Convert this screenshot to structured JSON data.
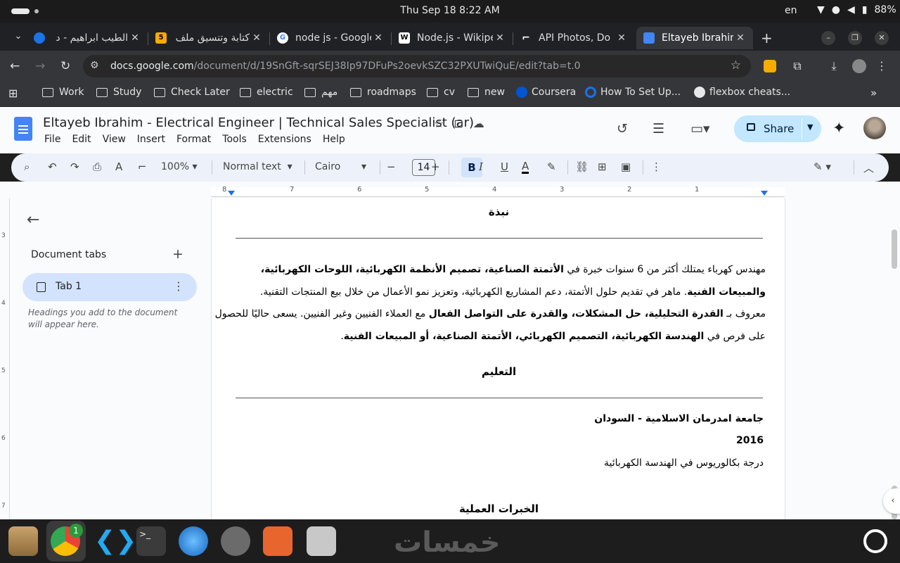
{
  "system": {
    "datetime": "Thu Sep 18  8:22 AM",
    "lang": "en",
    "battery": "88%"
  },
  "tabs": [
    {
      "title": "الطيب ابراهيم - د",
      "favicon_color": "#1a73e8"
    },
    {
      "title": "كتابة وتنسيق ملف",
      "favicon_color": "#f9ab00",
      "favicon_text": "5"
    },
    {
      "title": "node js - Google",
      "favicon_color": "#ffffff",
      "favicon_text": "G"
    },
    {
      "title": "Node.js - Wikipe",
      "favicon_color": "#ffffff",
      "favicon_text": "W"
    },
    {
      "title": "API Photos, Do",
      "favicon_color": "#202124",
      "favicon_text": "⌐"
    },
    {
      "title": "Eltayeb Ibrahim",
      "favicon_color": "#4285f4",
      "active": true
    }
  ],
  "address": {
    "url_host": "docs.google.com",
    "url_path": "/document/d/19SnGft-sqrSEJ38Ip97DFuPs2oevkSZC32PXUTwiQuE/edit?tab=t.0"
  },
  "bookmarks": [
    {
      "label": "Work",
      "type": "folder"
    },
    {
      "label": "Study",
      "type": "folder"
    },
    {
      "label": "Check Later",
      "type": "folder"
    },
    {
      "label": "electric",
      "type": "folder"
    },
    {
      "label": "مهم",
      "type": "folder"
    },
    {
      "label": "roadmaps",
      "type": "folder"
    },
    {
      "label": "cv",
      "type": "folder"
    },
    {
      "label": "new",
      "type": "folder"
    },
    {
      "label": "Coursera",
      "type": "site",
      "color": "#0056d2"
    },
    {
      "label": "How To Set Up...",
      "type": "site",
      "color": "#1a73e8"
    },
    {
      "label": "flexbox cheats...",
      "type": "site",
      "color": "#e8e8e8"
    }
  ],
  "doc": {
    "title": "Eltayeb Ibrahim - Electrical Engineer | Technical Sales Specialist (ar)",
    "menus": [
      "File",
      "Edit",
      "View",
      "Insert",
      "Format",
      "Tools",
      "Extensions",
      "Help"
    ],
    "share_label": "Share"
  },
  "toolbar": {
    "zoom": "100%",
    "style": "Normal text",
    "font": "Cairo",
    "size": "14"
  },
  "ruler_numbers": [
    "8",
    "7",
    "6",
    "5",
    "4",
    "3",
    "2",
    "1"
  ],
  "vruler_numbers": [
    "3",
    "4",
    "5",
    "6",
    "7"
  ],
  "sidebar": {
    "heading": "Document tabs",
    "tab_label": "Tab 1",
    "hint": "Headings you add to the document will appear here."
  },
  "content": {
    "summary_heading": "نبذة",
    "summary_lines": [
      {
        "parts": [
          [
            "مهندس كهرباء يمتلك أكثر من 6 سنوات خبرة في ",
            false
          ],
          [
            "الأتمتة الصناعية، تصميم الأنظمة الكهربائية، اللوحات الكهربائية،",
            true
          ]
        ]
      },
      {
        "parts": [
          [
            "والمبيعات الفنية",
            true
          ],
          [
            ". ماهر في تقديم حلول الأتمتة، دعم المشاريع الكهربائية، وتعزيز نمو الأعمال من خلال بيع المنتجات التقنية.",
            false
          ]
        ]
      },
      {
        "parts": [
          [
            "معروف بـ ",
            false
          ],
          [
            "القدرة التحليلية، حل المشكلات، والقدرة على التواصل الفعال",
            true
          ],
          [
            " مع العملاء الفنيين وغير الفنيين. يسعى حاليًا للحصول",
            false
          ]
        ]
      },
      {
        "parts": [
          [
            "على فرص في ",
            false
          ],
          [
            "الهندسة الكهربائية، التصميم الكهربائي، الأتمتة الصناعية، أو المبيعات الفنية",
            true
          ],
          [
            ".",
            false
          ]
        ]
      }
    ],
    "education_heading": "التعليم",
    "university": "جامعة امدرمان الاسلامية - السودان",
    "year": "2016",
    "degree": "درجة بكالوريوس في الهندسة الكهربائية",
    "experience_heading": "الخبرات العملية"
  },
  "dock": {
    "chrome_badge": "1",
    "watermark": "خمسات"
  }
}
